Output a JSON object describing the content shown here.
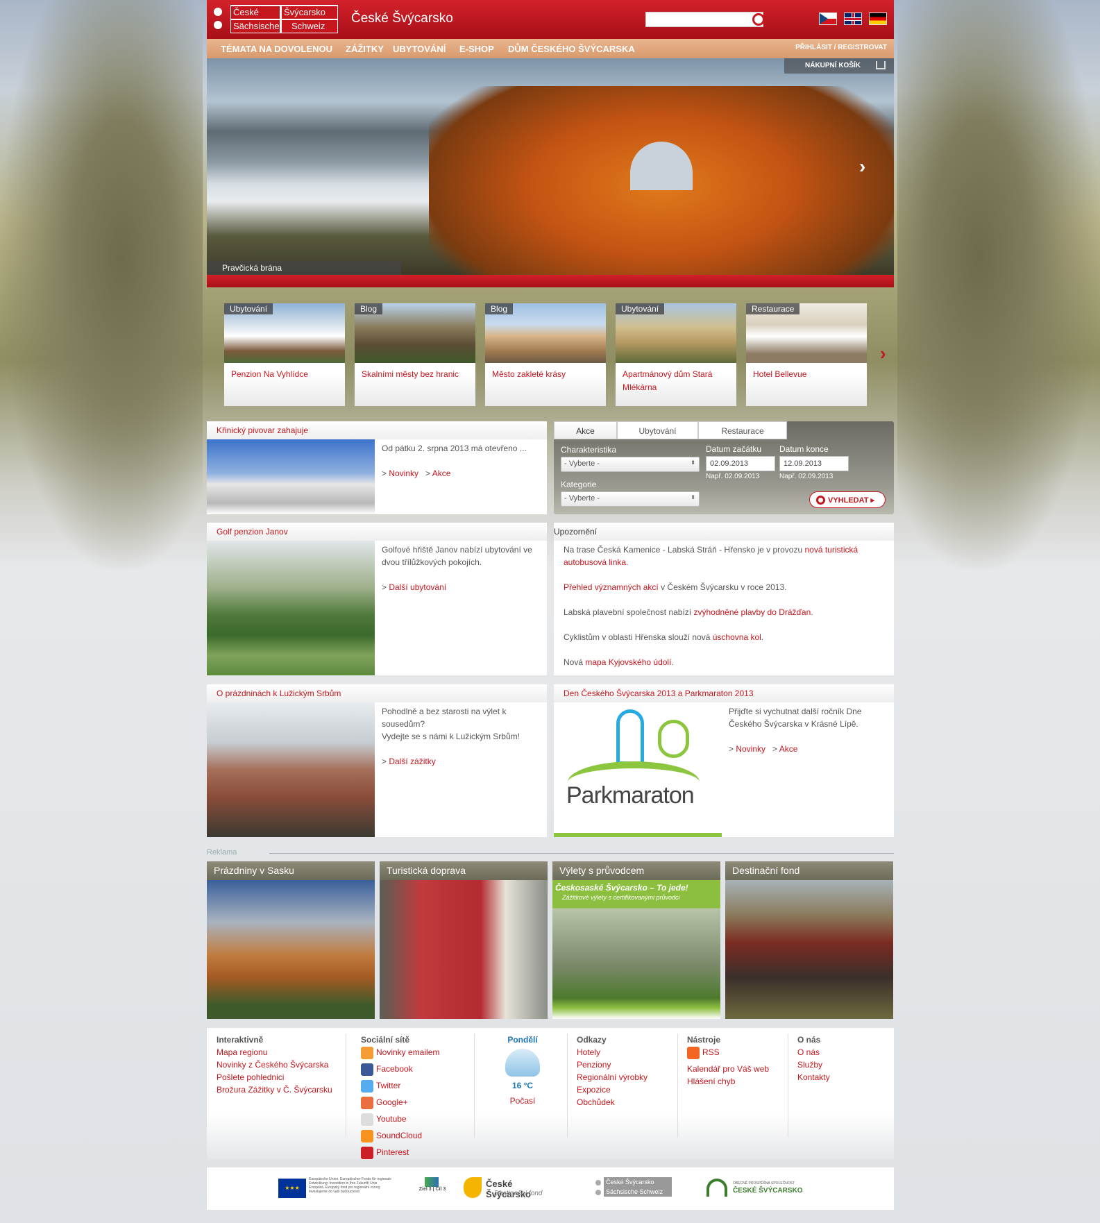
{
  "header": {
    "logo_top_left": "České",
    "logo_top_right": "Švýcarsko",
    "logo_bottom_left": "Sächsische",
    "logo_bottom_right": "Schweiz",
    "site_name": "České Švýcarsko",
    "search_placeholder": ""
  },
  "nav": {
    "items": [
      "TÉMATA NA DOVOLENOU",
      "ZÁŽITKY",
      "UBYTOVÁNÍ",
      "E-SHOP",
      "DŮM ČESKÉHO ŠVÝCARSKA"
    ],
    "login": "PŘIHLÁSIT / REGISTROVAT",
    "cart": "NÁKUPNÍ KOŠÍK"
  },
  "hero": {
    "caption": "Pravčická brána"
  },
  "tiles": [
    {
      "tag": "Ubytování",
      "title": "Penzion Na Vyhlídce"
    },
    {
      "tag": "Blog",
      "title": "Skalními městy bez hranic"
    },
    {
      "tag": "Blog",
      "title": "Město zakleté krásy"
    },
    {
      "tag": "Ubytování",
      "title": "Apartmánový dům Stará Mlékárna"
    },
    {
      "tag": "Restaurace",
      "title": "Hotel Bellevue"
    }
  ],
  "news": [
    {
      "title": "Křinický pivovar zahajuje",
      "text": "Od pátku 2. srpna 2013 má otevřeno ...",
      "links": [
        "Novinky",
        "Akce"
      ]
    },
    {
      "title": "Golf penzion Janov",
      "text": "Golfové hřiště Janov nabízí ubytování ve dvou třílůžkových pokojích.",
      "links": [
        "Další ubytování"
      ]
    },
    {
      "title": "O prázdninách k Lužickým Srbům",
      "text": "Pohodlně a bez starosti na výlet k sousedům?",
      "text2": "Vydejte se s námi k Lužickým Srbům!",
      "links": [
        "Další zážitky"
      ]
    },
    {
      "title": "Den Českého Švýcarska 2013 a Parkmaraton 2013",
      "text": "Přijďte si vychutnat další ročník Dne Českého Švýcarska v Krásné Lípě.",
      "links": [
        "Novinky",
        "Akce"
      ],
      "logo_text": "Parkmaraton"
    }
  ],
  "search": {
    "tabs": [
      "Akce",
      "Ubytování",
      "Restaurace"
    ],
    "char_label": "Charakteristika",
    "char_value": "- Vyberte -",
    "cat_label": "Kategorie",
    "cat_value": "- Vyberte -",
    "start_label": "Datum začátku",
    "start_value": "02.09.2013",
    "start_hint": "Např. 02.09.2013",
    "end_label": "Datum konce",
    "end_value": "12.09.2013",
    "end_hint": "Např. 02.09.2013",
    "button": "VYHLEDAT"
  },
  "notice": {
    "title": "Upozornění",
    "items": [
      {
        "pre": "Na trase Česká Kamenice - Labská Stráň - Hřensko je v provozu ",
        "link": "nová turistická autobusová linka",
        "post": "."
      },
      {
        "pre": "",
        "link": "Přehled významných akcí",
        "post": " v Českém Švýcarsku v roce 2013."
      },
      {
        "pre": "Labská plavební společnost nabízí ",
        "link": "zvýhodněné plavby do Drážďan",
        "post": "."
      },
      {
        "pre": "Cyklistům v oblasti Hřenska slouží nová ",
        "link": "úschovna kol",
        "post": "."
      },
      {
        "pre": "Nová ",
        "link": "mapa Kyjovského údolí",
        "post": "."
      }
    ]
  },
  "ads": {
    "label": "Reklama",
    "items": [
      "Prázdniny v Sasku",
      "Turistická doprava",
      "Výlety s průvodcem",
      "Destinační fond"
    ],
    "guide_banner": "Českosaské Švýcarsko – To jede!",
    "guide_sub": "Zážitkové výlety s certifikovanými průvodci"
  },
  "footer": {
    "interactive": {
      "title": "Interaktivně",
      "items": [
        "Mapa regionu",
        "Novinky z Českého Švýcarska",
        "Pošlete pohlednici",
        "Brožura Zážitky v Č. Švýcarsku"
      ]
    },
    "social": {
      "title": "Sociální sítě",
      "items": [
        "Novinky emailem",
        "Facebook",
        "Twitter",
        "Google+",
        "Youtube",
        "SoundCloud",
        "Pinterest"
      ]
    },
    "weather": {
      "day": "Pondělí",
      "temp": "16 °C",
      "link": "Počasí"
    },
    "links": {
      "title": "Odkazy",
      "items": [
        "Hotely",
        "Penziony",
        "Regionální výrobky",
        "Expozice",
        "Obchůdek"
      ]
    },
    "tools": {
      "title": "Nástroje",
      "items": [
        "RSS",
        "Kalendář pro Váš web",
        "Hlášení chyb"
      ]
    },
    "about": {
      "title": "O nás",
      "items": [
        "O nás",
        "Služby",
        "Kontakty"
      ]
    }
  },
  "partners": {
    "eu_text": "Europäische Union. Europäischer Fonds für regionale Entwicklung: Investition in Ihre Zukunft/ Unie Evropská, Evropský fond pro regionální rozvoj: Investujeme do vaší budoucnosti",
    "ziel": "Ziel 3 | Cíl 3",
    "fund_title": "České Švýcarsko",
    "fund_sub": "Destinační fond",
    "ops_top": "OBECNĚ PROSPĚŠNÁ SPOLEČNOST",
    "ops_name": "ČESKÉ ŠVÝCARSKO"
  },
  "colors": {
    "brand_red": "#c4161c",
    "nav_orange": "#dd9f73"
  }
}
